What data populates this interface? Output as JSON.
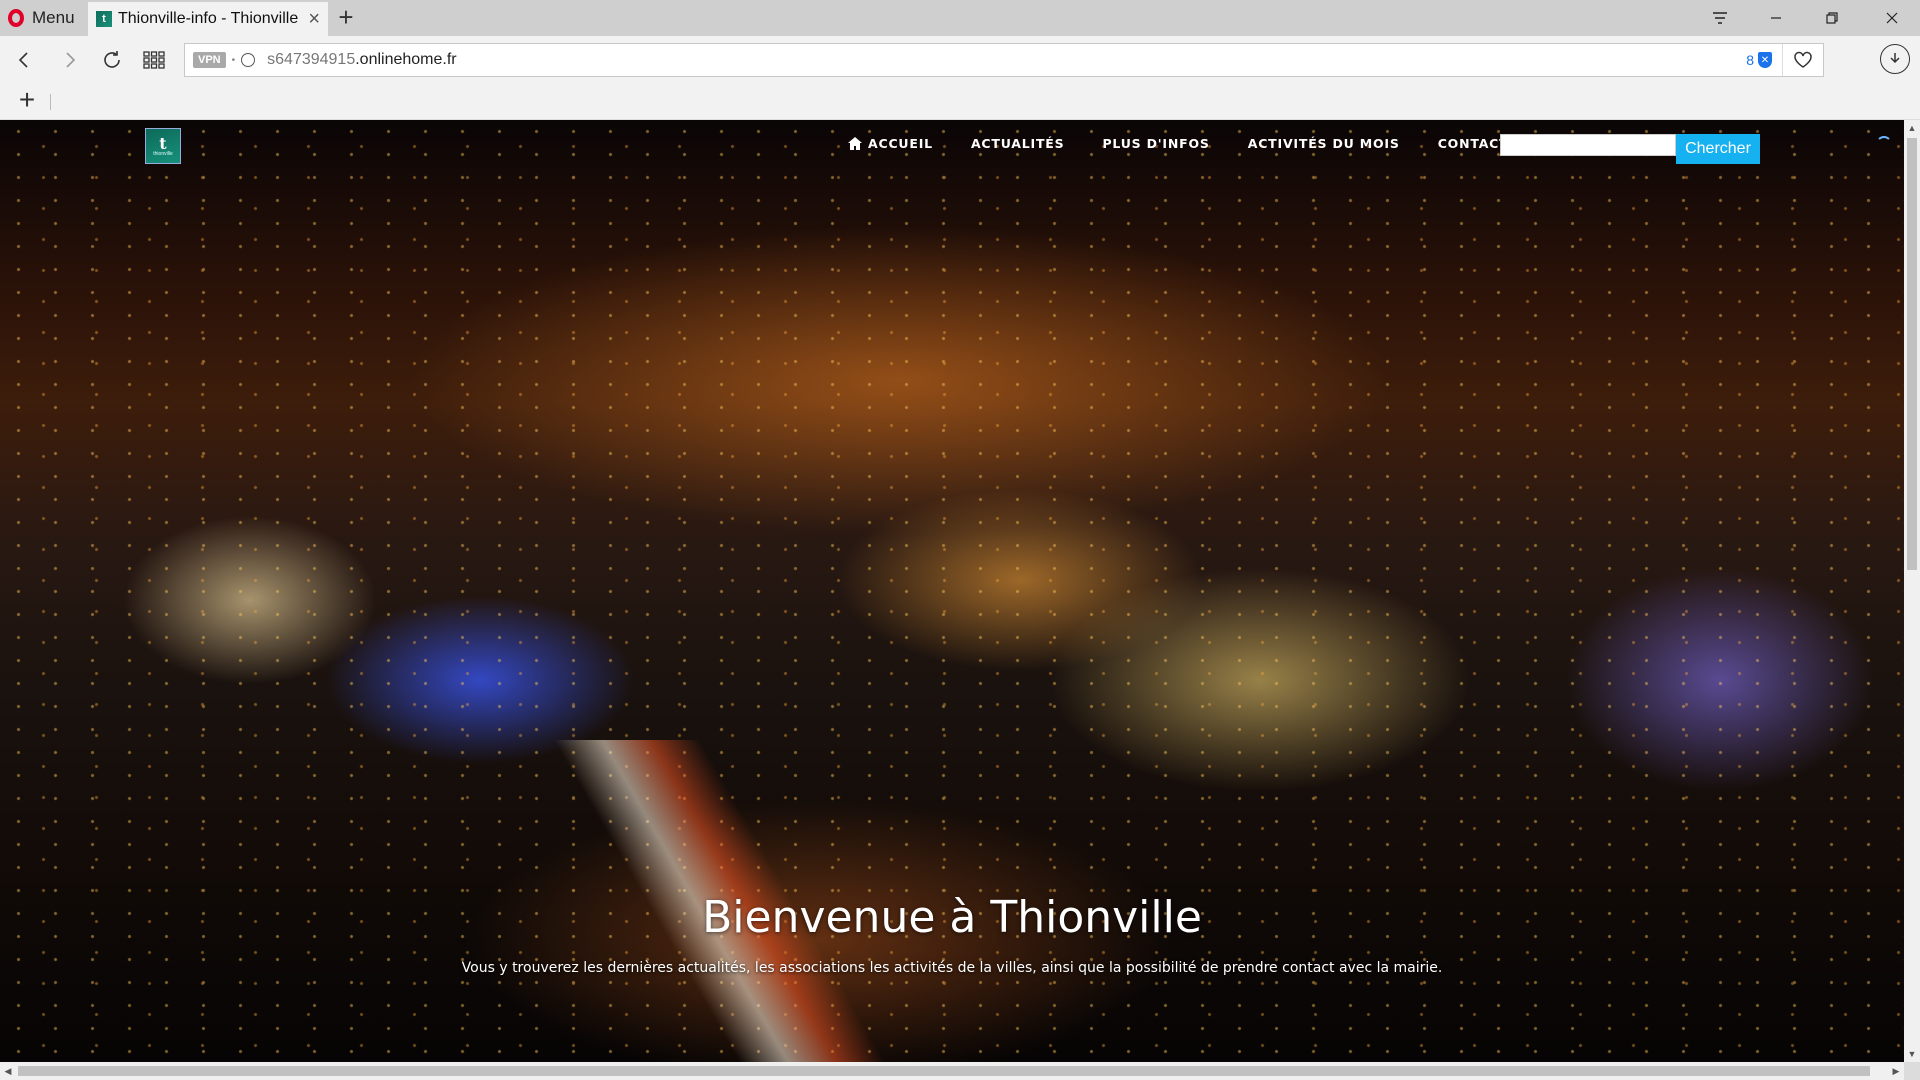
{
  "browser": {
    "menu_label": "Menu",
    "tab": {
      "title": "Thionville-info - Thionville",
      "favicon_letter": "t"
    },
    "url": {
      "host_prefix": "s647394915",
      "host_rest": ".onlinehome.fr"
    },
    "vpn_label": "VPN",
    "blocked_count": "8",
    "icons": {
      "back": "chevron-left-icon",
      "forward": "chevron-right-icon",
      "reload": "reload-icon",
      "speed_dial": "grid-icon",
      "heart": "heart-icon",
      "download": "download-icon"
    }
  },
  "site": {
    "logo_mark": "t",
    "logo_sub": "thionville",
    "nav": [
      {
        "label": "ACCUEIL",
        "icon": "home-icon"
      },
      {
        "label": "ACTUALITÉS"
      },
      {
        "label": "PLUS D'INFOS"
      },
      {
        "label": "ACTIVITÉS DU MOIS"
      },
      {
        "label": "CONTACTS"
      }
    ],
    "search": {
      "value": "",
      "button_label": "Chercher"
    },
    "hero": {
      "title": "Bienvenue à Thionville",
      "subtitle": "Vous y trouverez les dernières actualités, les associations les activités de la villes, ainsi que la possibilité de prendre contact avec la mairie."
    }
  },
  "colors": {
    "search_button": "#16b1f0",
    "opera_red": "#e0002a",
    "logo_green": "#0d6a5a"
  }
}
